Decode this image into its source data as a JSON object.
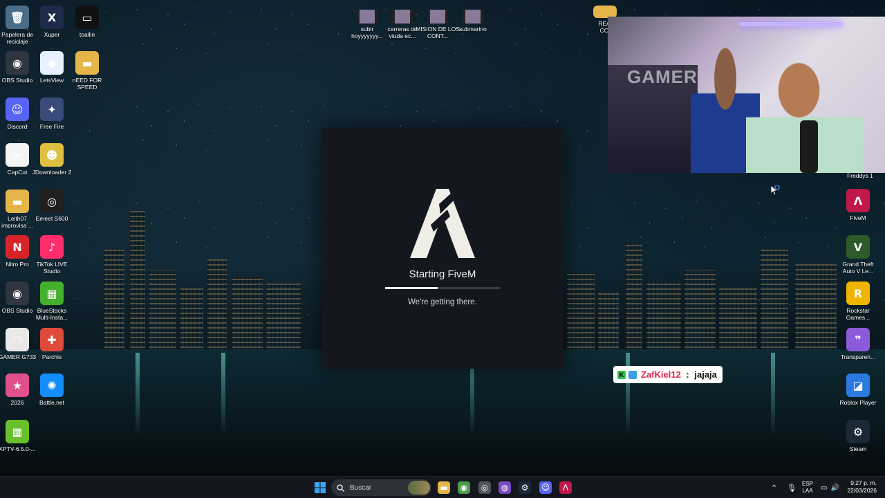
{
  "desktop": {
    "left_icons": [
      {
        "label": "Papelera de reciclaje",
        "icon": "recycle-bin-icon",
        "color": "#4a6e8a",
        "glyph": "🗑"
      },
      {
        "label": "Xuper",
        "icon": "xuper-icon",
        "color": "#1e2a4a",
        "glyph": "X"
      },
      {
        "label": "toallin",
        "icon": "video-file-icon",
        "color": "#111111",
        "glyph": "▭"
      },
      {
        "label": "OBS Studio",
        "icon": "obs-icon",
        "color": "#303540",
        "glyph": "◉"
      },
      {
        "label": "LetsView",
        "icon": "letsview-icon",
        "color": "#e8f2ff",
        "glyph": "◆"
      },
      {
        "label": "nEED FOR SPEED",
        "icon": "folder-icon",
        "color": "#e5b54a",
        "glyph": "▬"
      },
      {
        "label": "Discord",
        "icon": "discord-icon",
        "color": "#5865f2",
        "glyph": "☺"
      },
      {
        "label": "Free Fire",
        "icon": "free-fire-icon",
        "color": "#3a4a7a",
        "glyph": "✦"
      },
      {
        "label": "CapCut",
        "icon": "capcut-icon",
        "color": "#f4f4f4",
        "glyph": "✂"
      },
      {
        "label": "JDownloader 2",
        "icon": "jdownloader-icon",
        "color": "#e0c040",
        "glyph": "☻"
      },
      {
        "label": "Leith07 improvisa ...",
        "icon": "folder-icon",
        "color": "#e5b54a",
        "glyph": "▬"
      },
      {
        "label": "Emeet S600",
        "icon": "webcam-icon",
        "color": "#202020",
        "glyph": "◎"
      },
      {
        "label": "Nitro Pro",
        "icon": "nitro-pro-icon",
        "color": "#d8232a",
        "glyph": "N"
      },
      {
        "label": "TikTok LIVE Studio",
        "icon": "tiktok-icon",
        "color": "#ff2d6a",
        "glyph": "♪"
      },
      {
        "label": "OBS Studio",
        "icon": "obs-icon",
        "color": "#303540",
        "glyph": "◉"
      },
      {
        "label": "BlueStacks Multi-Insta...",
        "icon": "bluestacks-icon",
        "color": "#44b02c",
        "glyph": "▦"
      },
      {
        "label": "GAMER G733",
        "icon": "headset-icon",
        "color": "#e8e8e8",
        "glyph": "◠"
      },
      {
        "label": "Parchis",
        "icon": "parchis-icon",
        "color": "#e04a3a",
        "glyph": "✚"
      },
      {
        "label": "2026",
        "icon": "game-icon",
        "color": "#e0508a",
        "glyph": "★"
      },
      {
        "label": "Battle.net",
        "icon": "battlenet-icon",
        "color": "#148eff",
        "glyph": "✺"
      },
      {
        "label": "XPTV-6.5.0-...",
        "icon": "bluestacks-icon",
        "color": "#6ac02c",
        "glyph": "▦"
      }
    ],
    "top_icons": [
      {
        "label": "subir hoyyyyyyy...",
        "icon": "video-file-icon"
      },
      {
        "label": "carreras de viuda ec...",
        "icon": "video-file-icon"
      },
      {
        "label": "MISION DE LOS CONT...",
        "icon": "video-file-icon"
      },
      {
        "label": "submarino",
        "icon": "video-file-icon"
      }
    ],
    "right_icons": [
      {
        "label": "FiveM",
        "icon": "fivem-icon",
        "color": "#c0184a",
        "glyph": "Λ"
      },
      {
        "label": "Grand Theft Auto V Le...",
        "icon": "gta-icon",
        "color": "#2c5a2a",
        "glyph": "V"
      },
      {
        "label": "Rockstar Games...",
        "icon": "rockstar-icon",
        "color": "#f0b400",
        "glyph": "R"
      },
      {
        "label": "Transparen...",
        "icon": "chat-icon",
        "color": "#8a5ad8",
        "glyph": "❞"
      },
      {
        "label": "Roblox Player",
        "icon": "roblox-icon",
        "color": "#2a7ae0",
        "glyph": "◪"
      },
      {
        "label": "Steam",
        "icon": "steam-icon",
        "color": "#1b2838",
        "glyph": "⚙"
      }
    ],
    "partial_labels": {
      "rea": "REA CO",
      "freddys": "Freddys 1"
    }
  },
  "splash": {
    "title": "Starting FiveM",
    "subtitle": "We're getting there.",
    "progress": 0.46,
    "bg": "#15171e"
  },
  "webcam": {
    "watermark": "GAMER"
  },
  "chat": {
    "username": "ZafKiel12",
    "separator": " : ",
    "message": "jajaja",
    "username_color": "#e0244c"
  },
  "taskbar": {
    "search_placeholder": "Buscar",
    "apps": [
      {
        "name": "file-explorer-icon",
        "glyph": "▬",
        "color": "#e5b54a"
      },
      {
        "name": "chrome-icon",
        "glyph": "◉",
        "color": "#4a9a4a"
      },
      {
        "name": "obs-icon",
        "glyph": "◎",
        "color": "#505560"
      },
      {
        "name": "podcast-icon",
        "glyph": "◍",
        "color": "#7a4ac0"
      },
      {
        "name": "steam-icon",
        "glyph": "⚙",
        "color": "#1b2838"
      },
      {
        "name": "discord-icon",
        "glyph": "☺",
        "color": "#5865f2"
      },
      {
        "name": "fivem-icon",
        "glyph": "Λ",
        "color": "#c0184a"
      }
    ],
    "language": "ESP",
    "language_sub": "LAA",
    "time": "9:27 p. m.",
    "date": "22/03/2026"
  }
}
